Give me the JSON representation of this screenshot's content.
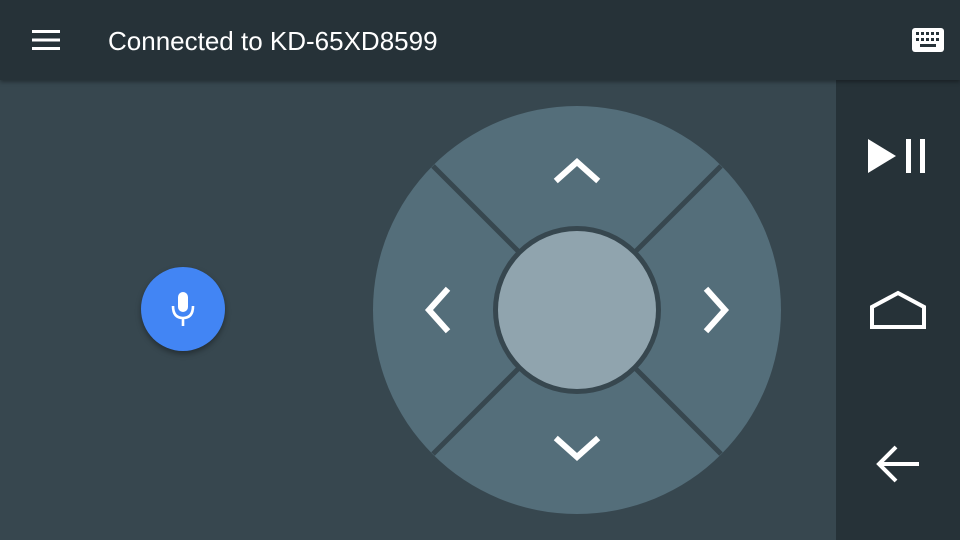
{
  "header": {
    "title": "Connected to KD-65XD8599",
    "menu_icon": "hamburger-menu-icon",
    "keyboard_icon": "keyboard-icon"
  },
  "colors": {
    "topbar": "#263238",
    "background": "#37474f",
    "dpad_ring": "#546e7a",
    "dpad_center": "#90a4ae",
    "mic_button": "#4285f4",
    "icon": "#ffffff"
  },
  "voice": {
    "icon": "microphone-icon"
  },
  "dpad": {
    "up_icon": "chevron-up-icon",
    "down_icon": "chevron-down-icon",
    "left_icon": "chevron-left-icon",
    "right_icon": "chevron-right-icon",
    "center": "select-button"
  },
  "side_controls": {
    "play_pause_icon": "play-pause-icon",
    "home_icon": "home-icon",
    "back_icon": "back-arrow-icon"
  }
}
